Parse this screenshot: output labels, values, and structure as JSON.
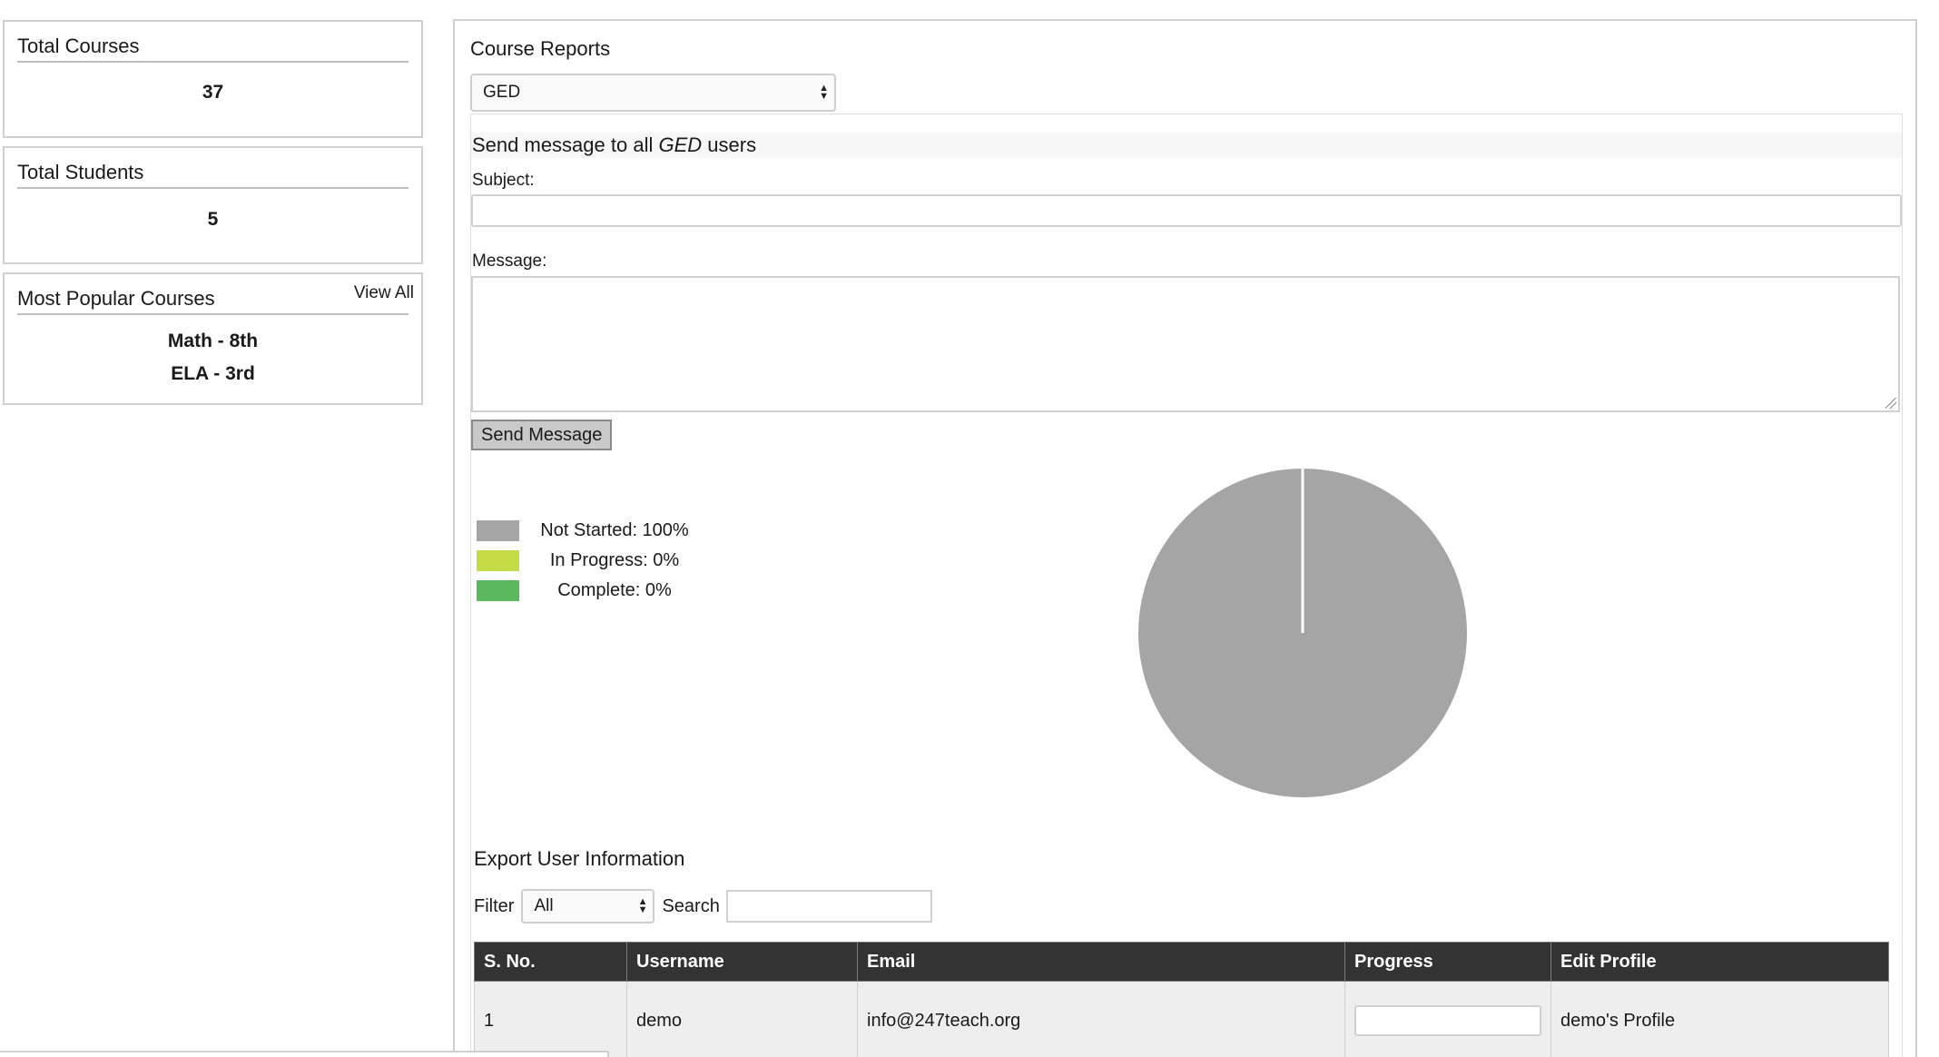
{
  "stats": {
    "total_courses": {
      "title": "Total Courses",
      "value": "37"
    },
    "total_students": {
      "title": "Total Students",
      "value": "5"
    },
    "popular": {
      "title": "Most Popular Courses",
      "view_all": "View All",
      "items": [
        "Math - 8th",
        "ELA - 3rd"
      ]
    }
  },
  "reports": {
    "title": "Course Reports",
    "selected_course": "GED",
    "message": {
      "heading_prefix": "Send message to all ",
      "heading_course": "GED",
      "heading_suffix": " users",
      "subject_label": "Subject:",
      "subject_value": "",
      "message_label": "Message:",
      "message_value": "",
      "send_label": "Send Message"
    }
  },
  "legend": [
    {
      "label": "Not Started: 100%",
      "color": "#a5a5a5"
    },
    {
      "label": "In Progress: 0%",
      "color": "#c5dc46"
    },
    {
      "label": "Complete: 0%",
      "color": "#5cb85c"
    }
  ],
  "chart_data": {
    "type": "pie",
    "slices": [
      {
        "label": "Not Started",
        "value": 100,
        "color": "#a5a5a5"
      },
      {
        "label": "In Progress",
        "value": 0,
        "color": "#c5dc46"
      },
      {
        "label": "Complete",
        "value": 0,
        "color": "#5cb85c"
      }
    ]
  },
  "export": {
    "title": "Export User Information",
    "filter_label": "Filter",
    "filter_value": "All",
    "search_label": "Search",
    "search_value": ""
  },
  "table": {
    "headers": [
      "S. No.",
      "Username",
      "Email",
      "Progress",
      "Edit Profile"
    ],
    "rows": [
      {
        "sno": "1",
        "username": "demo",
        "email": "info@247teach.org",
        "progress": "",
        "profile": "demo's Profile"
      }
    ]
  }
}
